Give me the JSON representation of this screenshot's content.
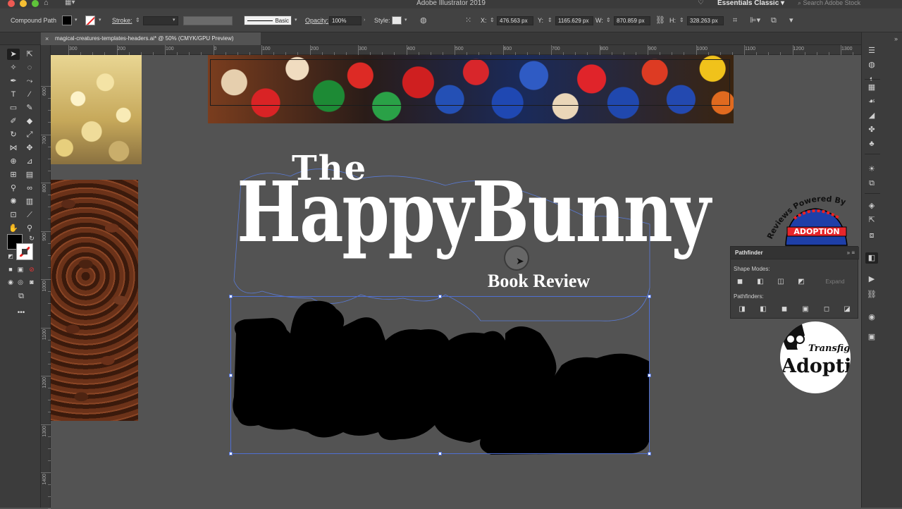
{
  "app": {
    "title": "Adobe Illustrator 2019",
    "workspace": "Essentials Classic",
    "stock_search_placeholder": "Search Adobe Stock"
  },
  "control_bar": {
    "selection_type": "Compound Path",
    "stroke_label": "Stroke:",
    "stroke_profile": "Basic",
    "opacity_label": "Opacity:",
    "opacity_value": "100%",
    "style_label": "Style:",
    "x_label": "X:",
    "x_value": "476.563 px",
    "y_label": "Y:",
    "y_value": "1165.629 px",
    "w_label": "W:",
    "w_value": "870.859 px",
    "h_label": "H:",
    "h_value": "328.263 px"
  },
  "document": {
    "tab_title": "magical-creatures-templates-headers.ai* @ 50% (CMYK/GPU Preview)",
    "close_glyph": "×",
    "collapse_glyph": "»"
  },
  "rulers": {
    "horizontal": [
      "300",
      "200",
      "100",
      "0",
      "100",
      "200",
      "300",
      "400",
      "500",
      "600",
      "700",
      "800",
      "900",
      "1000",
      "1100",
      "1200",
      "1300"
    ],
    "vertical": [
      "600",
      "700",
      "800",
      "900",
      "1000",
      "1100",
      "1200",
      "1300",
      "1400"
    ]
  },
  "artwork": {
    "title_the": "The",
    "title_main": "HappyBunny",
    "subtitle": "Book Review",
    "logo_adoption_arc": "Reviews Powered By",
    "logo_adoption_word": "ADOPTION",
    "logo_transfig_top": "Transfiguri",
    "logo_transfig_word": "Adoptio"
  },
  "pathfinder": {
    "title": "Pathfinder",
    "shape_modes_label": "Shape Modes:",
    "pathfinders_label": "Pathfinders:",
    "expand_label": "Expand"
  }
}
